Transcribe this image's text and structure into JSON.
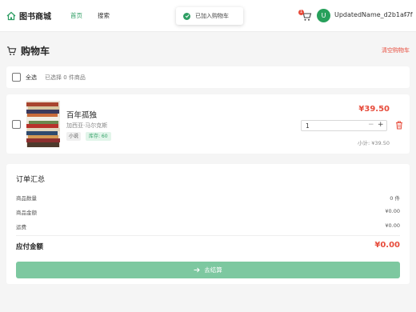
{
  "header": {
    "logo_text": "图书商城",
    "nav": {
      "home": "首页",
      "search": "搜索"
    },
    "toast": "已加入购物车",
    "cart_badge": "1",
    "avatar_letter": "U",
    "username": "UpdatedName_d2b1af7f",
    "chevron": "⌄"
  },
  "page": {
    "title": "购物车",
    "clear_label": "清空购物车"
  },
  "select_bar": {
    "select_all_label": "全选",
    "selected_text": "已选择 0 件商品"
  },
  "items": [
    {
      "name": "百年孤独",
      "author": "加西亚·马尔克斯",
      "category": "小说",
      "stock": "库存: 60",
      "price": "¥39.50",
      "quantity": "1",
      "subtotal": "小计: ¥39.50"
    }
  ],
  "summary": {
    "title": "订单汇总",
    "rows": [
      {
        "label": "商品数量",
        "value": "0 件"
      },
      {
        "label": "商品金额",
        "value": "¥0.00"
      },
      {
        "label": "运费",
        "value": "¥0.00"
      }
    ],
    "total_label": "应付金额",
    "total_value": "¥0.00",
    "checkout_label": "去结算"
  },
  "colors": {
    "brand_green": "#2e9e63",
    "price_red": "#e74c3c",
    "checkout_disabled": "#7dc8a0"
  }
}
